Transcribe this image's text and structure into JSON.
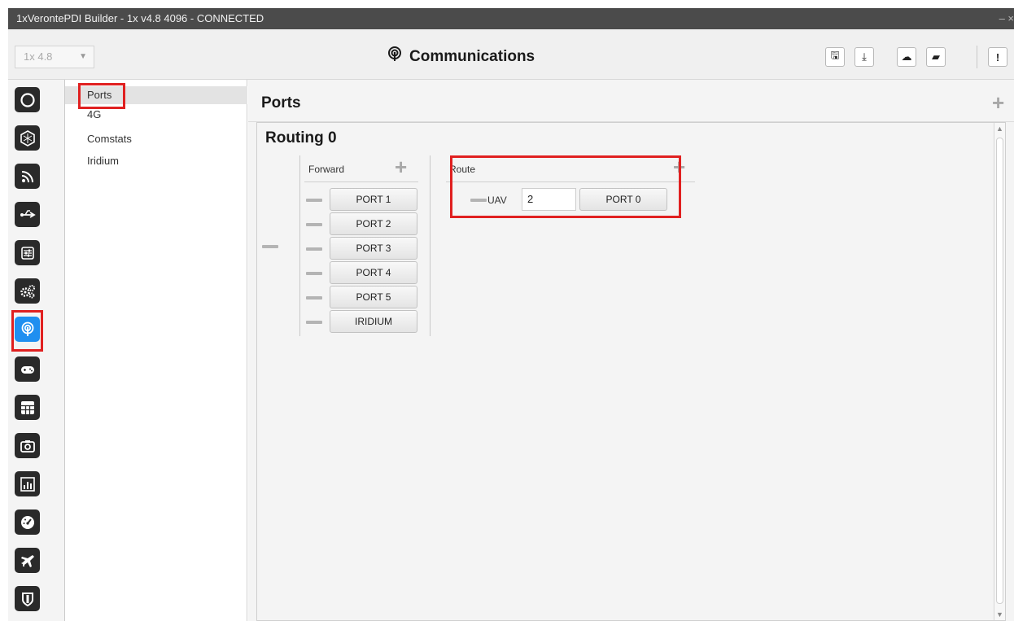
{
  "window": {
    "title": "1xVerontePDI Builder - 1x v4.8 4096 - CONNECTED",
    "controls": "– ×"
  },
  "toolbar": {
    "version_select": "1x 4.8",
    "page_title": "Communications",
    "buttons": [
      {
        "name": "save",
        "icon": "save-icon",
        "glyph": "🖫"
      },
      {
        "name": "download",
        "icon": "download-icon",
        "glyph": "⤓"
      },
      {
        "name": "cloud",
        "icon": "cloud-icon",
        "glyph": "☁"
      },
      {
        "name": "open-folder",
        "icon": "folder-open-icon",
        "glyph": "▰"
      },
      {
        "name": "alert",
        "icon": "alert-icon",
        "glyph": "!"
      }
    ]
  },
  "sidebar": {
    "icons": [
      "status-icon",
      "hexagon-icon",
      "rss-icon",
      "usb-icon",
      "sliders-icon",
      "gears-icon",
      "antenna-icon",
      "gamepad-icon",
      "keypad-icon",
      "camera-icon",
      "chart-icon",
      "speedometer-icon",
      "airplane-icon",
      "shield-icon"
    ],
    "active_icon": "antenna-icon"
  },
  "submenu": {
    "items": [
      "Ports",
      "4G",
      "Comstats",
      "Iridium"
    ],
    "selected": "Ports"
  },
  "main": {
    "header": "Ports",
    "routing": {
      "title": "Routing 0",
      "forward_label": "Forward",
      "forward_ports": [
        "PORT 1",
        "PORT 2",
        "PORT 3",
        "PORT 4",
        "PORT 5",
        "IRIDIUM"
      ],
      "route_label": "Route",
      "route_uav_label": "UAV",
      "route_uav_value": "2",
      "route_port": "PORT 0"
    }
  },
  "colors": {
    "highlight": "#e02020",
    "active_icon": "#1f8ff0",
    "icon_bg": "#2a2a2a"
  }
}
